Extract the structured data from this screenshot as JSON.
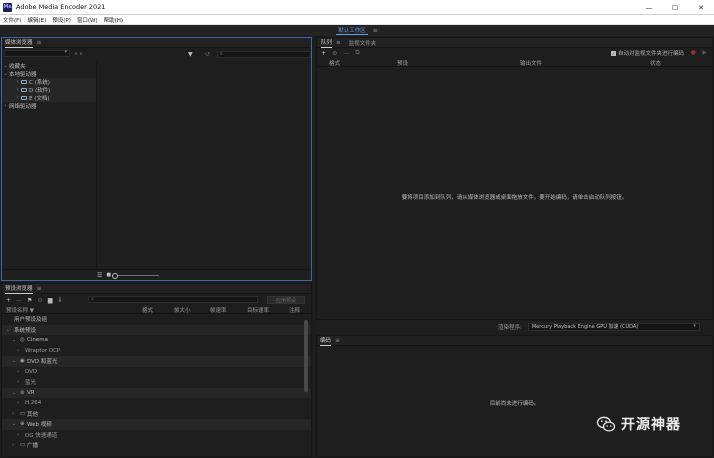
{
  "window": {
    "title": "Adobe Media Encoder 2021",
    "icon_text": "Me"
  },
  "menu": [
    "文件(F)",
    "编辑(E)",
    "预设(P)",
    "窗口(W)",
    "帮助(H)"
  ],
  "workspace": {
    "label": "默认工作区"
  },
  "media_browser": {
    "title": "媒体浏览器",
    "search_placeholder": "",
    "tree": [
      {
        "label": "收藏夹",
        "level": 0
      },
      {
        "label": "本地驱动器",
        "level": 0
      },
      {
        "label": "C (系统)",
        "level": 1,
        "drive": true
      },
      {
        "label": "D (软件)",
        "level": 1,
        "drive": true
      },
      {
        "label": "E (文档)",
        "level": 1,
        "drive": true
      },
      {
        "label": "网络驱动器",
        "level": 0
      }
    ]
  },
  "queue": {
    "tabs": [
      "队列",
      "监视文件夹"
    ],
    "auto_encode_label": "自动对监视文件夹进行编码",
    "columns": [
      "格式",
      "预设",
      "输出文件",
      "状态"
    ],
    "empty_message": "要将项目添加到队列，请从媒体浏览器或桌面拖放文件。要开始编码，请单击启动队列按钮。"
  },
  "preset_browser": {
    "title": "预设浏览器",
    "apply_label": "应用预设",
    "columns": [
      "预设名称 ▼",
      "格式",
      "帧大小",
      "帧速率",
      "目标速率",
      "注释"
    ],
    "rows": [
      {
        "label": "用户预设及组",
        "type": "plain"
      },
      {
        "label": "系统预设",
        "type": "root"
      },
      {
        "label": "Cinema",
        "type": "group",
        "icon": "cinema-icon"
      },
      {
        "label": "Wraptor DCP",
        "type": "sub"
      },
      {
        "label": "DVD 和蓝光",
        "type": "group",
        "icon": "disc-icon"
      },
      {
        "label": "DVD",
        "type": "sub"
      },
      {
        "label": "蓝光",
        "type": "sub"
      },
      {
        "label": "VR",
        "type": "group",
        "icon": "vr-icon"
      },
      {
        "label": "H.264",
        "type": "sub"
      },
      {
        "label": "其他",
        "type": "group",
        "icon": "monitor-icon"
      },
      {
        "label": "Web 视频",
        "type": "group",
        "icon": "globe-icon"
      },
      {
        "label": "DG 快速通道",
        "type": "sub"
      },
      {
        "label": "广播",
        "type": "group",
        "icon": "broadcast-icon"
      }
    ]
  },
  "renderer": {
    "label": "渲染程序:",
    "value": "Mercury Playback Engine GPU 加速 (CUDA)"
  },
  "encoding": {
    "title": "编码",
    "empty_message": "目前尚未进行编码。"
  },
  "watermark": {
    "text": "开源神器"
  }
}
